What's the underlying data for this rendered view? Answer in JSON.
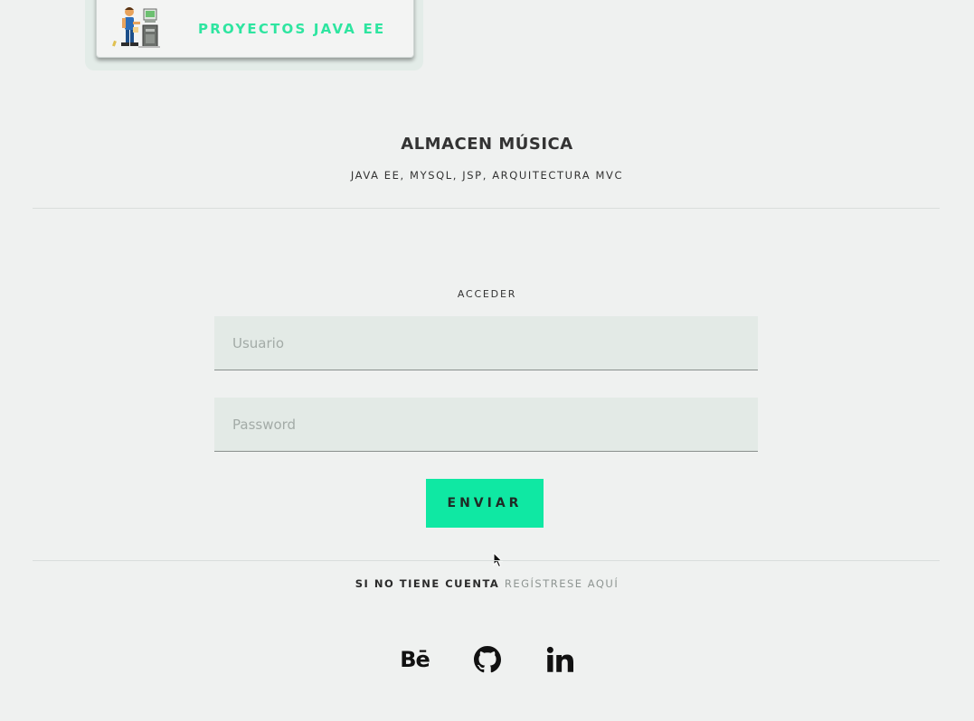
{
  "header": {
    "card_title": "PROYECTOS JAVA EE"
  },
  "app": {
    "title": "ALMACEN MÚSICA",
    "subtitle": "JAVA EE, MYSQL, JSP, ARQUITECTURA MVC"
  },
  "login": {
    "heading": "ACCEDER",
    "username_placeholder": "Usuario",
    "username_value": "",
    "password_placeholder": "Password",
    "password_value": "",
    "submit_label": "ENVIAR"
  },
  "register": {
    "prefix": "SI NO TIENE CUENTA",
    "link_label": "REGÍSTRESE AQUÍ"
  },
  "social": [
    {
      "name": "behance-icon",
      "label": "Bē"
    },
    {
      "name": "github-icon"
    },
    {
      "name": "linkedin-icon"
    }
  ],
  "colors": {
    "accent": "#0fe8a3",
    "accent_text": "#2ee5a0",
    "background": "#eff1f0",
    "field_background": "#e3eae6"
  }
}
